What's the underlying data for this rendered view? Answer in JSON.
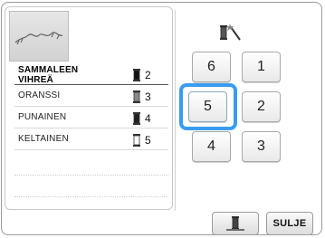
{
  "colors": [
    {
      "name": "SAMMALEEN VIHREÄ",
      "order": "2",
      "spool_fill": "#111111"
    },
    {
      "name": "ORANSSI",
      "order": "3",
      "spool_fill": "#8a8a8a"
    },
    {
      "name": "PUNAINEN",
      "order": "4",
      "spool_fill": "#222222"
    },
    {
      "name": "KELTAINEN",
      "order": "5",
      "spool_fill": "#ffffff"
    }
  ],
  "selected_number": "5",
  "number_buttons": [
    "6",
    "1",
    "5",
    "2",
    "4",
    "3"
  ],
  "bottom": {
    "close_label": "SULJE"
  },
  "icons": {
    "preview": "embroidery-preview",
    "wand": "magic-wand-spool-icon",
    "spool": "thread-spool-icon"
  }
}
